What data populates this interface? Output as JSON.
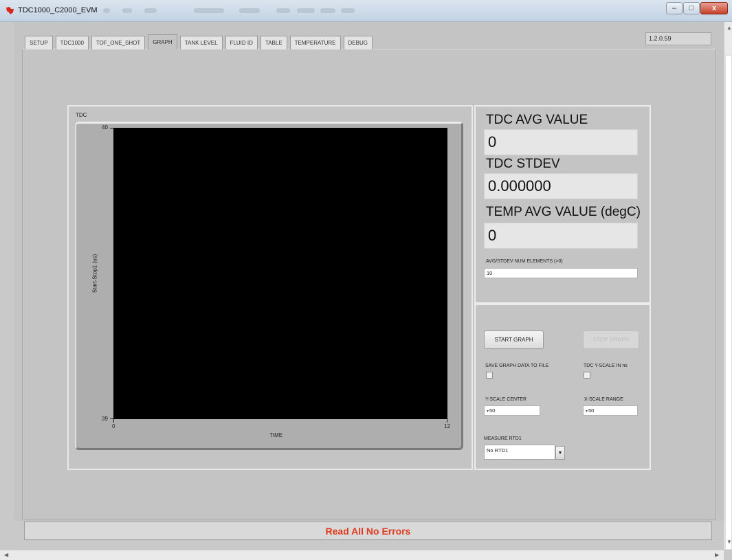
{
  "window": {
    "title": "TDC1000_C2000_EVM",
    "controls": {
      "minimize": "–",
      "maximize": "□",
      "close": "x"
    }
  },
  "version": "1.2.0.59",
  "tabs": [
    {
      "label": "SETUP",
      "active": false
    },
    {
      "label": "TDC1000",
      "active": false
    },
    {
      "label": "TOF_ONE_SHOT",
      "active": false
    },
    {
      "label": "GRAPH",
      "active": true
    },
    {
      "label": "TANK LEVEL",
      "active": false
    },
    {
      "label": "FLUID ID",
      "active": false
    },
    {
      "label": "TABLE",
      "active": false
    },
    {
      "label": "TEMPERATURE",
      "active": false
    },
    {
      "label": "DEBUG",
      "active": false
    }
  ],
  "graph": {
    "name": "TDC",
    "xlabel": "TIME",
    "ylabel": "Start-Stop1 (us)",
    "x_ticks": [
      "0",
      "12"
    ],
    "y_ticks": [
      "40",
      "39"
    ]
  },
  "chart_data": {
    "type": "line",
    "title": "TDC",
    "xlabel": "TIME",
    "ylabel": "Start-Stop1 (us)",
    "xlim": [
      0,
      12
    ],
    "ylim": [
      39,
      40
    ],
    "series": []
  },
  "readouts": {
    "tdc_avg_label": "TDC AVG VALUE",
    "tdc_avg_value": "0",
    "tdc_stdev_label": "TDC STDEV",
    "tdc_stdev_value": "0.000000",
    "temp_avg_label": "TEMP AVG VALUE (degC)",
    "temp_avg_value": "0",
    "num_elements_label": "AVG/STDEV NUM ELEMENTS (>0)",
    "num_elements_value": "10"
  },
  "controls": {
    "start_graph": "START GRAPH",
    "stop_graph": "STOP GRAPH",
    "save_graph_label": "SAVE GRAPH DATA TO FILE",
    "save_graph_checked": false,
    "yscale_ns_label": "TDC Y-SCALE IN ns",
    "yscale_ns_checked": false,
    "y_center_label": "Y-SCALE CENTER",
    "y_center_value": "50",
    "x_range_label": "X-SCALE RANGE",
    "x_range_value": "50",
    "measure_rtd_label": "MEASURE RTD1",
    "measure_rtd_value": "No RTD1"
  },
  "status": {
    "text": "Read All No Errors",
    "color": "#e03a1e"
  },
  "icons": {
    "app": "ti-logo-icon",
    "dropdown": "chevron-down-icon"
  }
}
